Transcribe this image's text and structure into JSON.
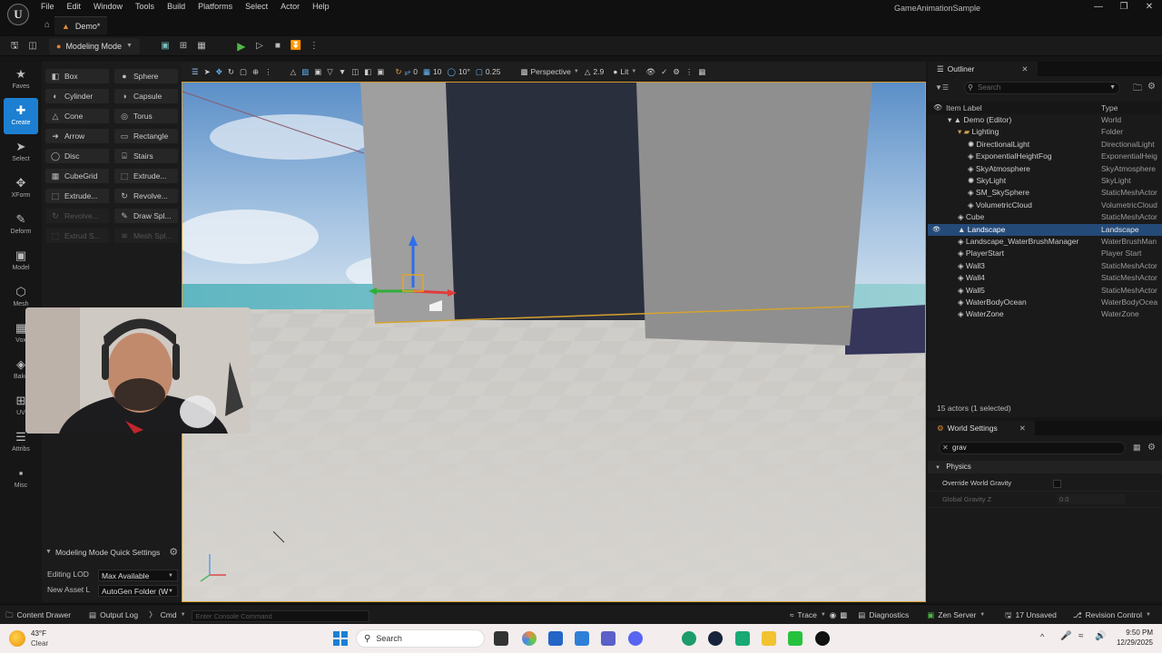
{
  "app": {
    "title": "GameAnimationSample",
    "level_tab": "Demo*",
    "menus": [
      "File",
      "Edit",
      "Window",
      "Tools",
      "Build",
      "Platforms",
      "Select",
      "Actor",
      "Help"
    ]
  },
  "toolbar": {
    "mode_label": "Modeling Mode"
  },
  "modebar": {
    "items": [
      {
        "label": "Faves",
        "icon": "star-icon"
      },
      {
        "label": "Create",
        "icon": "create-icon"
      },
      {
        "label": "Select",
        "icon": "select-icon"
      },
      {
        "label": "XForm",
        "icon": "xform-icon"
      },
      {
        "label": "Deform",
        "icon": "deform-icon"
      },
      {
        "label": "Model",
        "icon": "model-icon"
      },
      {
        "label": "Mesh",
        "icon": "mesh-icon"
      },
      {
        "label": "Vox",
        "icon": "vox-icon"
      },
      {
        "label": "Bake",
        "icon": "bake-icon"
      },
      {
        "label": "UV",
        "icon": "uv-icon"
      },
      {
        "label": "Attribs",
        "icon": "attribs-icon"
      },
      {
        "label": "Misc",
        "icon": "misc-icon"
      }
    ],
    "active": "Create"
  },
  "palette": {
    "tools": [
      {
        "label": "Box",
        "icon": "box-icon",
        "enabled": true
      },
      {
        "label": "Sphere",
        "icon": "sphere-icon",
        "enabled": true
      },
      {
        "label": "Cylinder",
        "icon": "cylinder-icon",
        "enabled": true
      },
      {
        "label": "Capsule",
        "icon": "capsule-icon",
        "enabled": true
      },
      {
        "label": "Cone",
        "icon": "cone-icon",
        "enabled": true
      },
      {
        "label": "Torus",
        "icon": "torus-icon",
        "enabled": true
      },
      {
        "label": "Arrow",
        "icon": "arrow-icon",
        "enabled": true
      },
      {
        "label": "Rectangle",
        "icon": "rectangle-icon",
        "enabled": true
      },
      {
        "label": "Disc",
        "icon": "disc-icon",
        "enabled": true
      },
      {
        "label": "Stairs",
        "icon": "stairs-icon",
        "enabled": true
      },
      {
        "label": "CubeGrid",
        "icon": "cubegrid-icon",
        "enabled": true
      },
      {
        "label": "Extrude...",
        "icon": "extrude-icon",
        "enabled": true
      },
      {
        "label": "Extrude...",
        "icon": "extrude-path-icon",
        "enabled": true
      },
      {
        "label": "Revolve...",
        "icon": "revolve-icon",
        "enabled": true
      },
      {
        "label": "Revolve...",
        "icon": "revolve-path-icon",
        "enabled": false
      },
      {
        "label": "Draw Spl...",
        "icon": "draw-spline-icon",
        "enabled": true
      },
      {
        "label": "Extrud S...",
        "icon": "extrude-spline-icon",
        "enabled": false
      },
      {
        "label": "Mesh Spl...",
        "icon": "mesh-spline-icon",
        "enabled": false
      }
    ]
  },
  "quick_settings": {
    "title": "Modeling Mode Quick Settings",
    "editing_lod_label": "Editing LOD",
    "editing_lod_value": "Max Available",
    "new_asset_label": "New Asset L",
    "new_asset_value": "AutoGen Folder (W"
  },
  "viewport_toolbar": {
    "grid_rot": "0",
    "snap_move": "10",
    "snap_rot": "10°",
    "snap_scale": "0.25",
    "view_mode": "Perspective",
    "camera_speed": "2.9",
    "lighting": "Lit"
  },
  "outliner": {
    "tab": "Outliner",
    "search_placeholder": "Search",
    "col_label": "Item Label",
    "col_type": "Type",
    "rows": [
      {
        "name": "Demo (Editor)",
        "type": "World",
        "depth": 0,
        "kind": "world"
      },
      {
        "name": "Lighting",
        "type": "Folder",
        "depth": 1,
        "kind": "folder"
      },
      {
        "name": "DirectionalLight",
        "type": "DirectionalLight",
        "depth": 2,
        "kind": "light"
      },
      {
        "name": "ExponentialHeightFog",
        "type": "ExponentialHeig",
        "depth": 2,
        "kind": "actor"
      },
      {
        "name": "SkyAtmosphere",
        "type": "SkyAtmosphere",
        "depth": 2,
        "kind": "actor"
      },
      {
        "name": "SkyLight",
        "type": "SkyLight",
        "depth": 2,
        "kind": "light"
      },
      {
        "name": "SM_SkySphere",
        "type": "StaticMeshActor",
        "depth": 2,
        "kind": "actor"
      },
      {
        "name": "VolumetricCloud",
        "type": "VolumetricCloud",
        "depth": 2,
        "kind": "actor"
      },
      {
        "name": "Cube",
        "type": "StaticMeshActor",
        "depth": 1,
        "kind": "actor"
      },
      {
        "name": "Landscape",
        "type": "Landscape",
        "depth": 1,
        "kind": "landscape",
        "selected": true
      },
      {
        "name": "Landscape_WaterBrushManager",
        "type": "WaterBrushMan",
        "depth": 1,
        "kind": "actor"
      },
      {
        "name": "PlayerStart",
        "type": "Player Start",
        "depth": 1,
        "kind": "actor"
      },
      {
        "name": "Wall3",
        "type": "StaticMeshActor",
        "depth": 1,
        "kind": "actor"
      },
      {
        "name": "Wall4",
        "type": "StaticMeshActor",
        "depth": 1,
        "kind": "actor"
      },
      {
        "name": "Wall5",
        "type": "StaticMeshActor",
        "depth": 1,
        "kind": "actor"
      },
      {
        "name": "WaterBodyOcean",
        "type": "WaterBodyOcea",
        "depth": 1,
        "kind": "actor"
      },
      {
        "name": "WaterZone",
        "type": "WaterZone",
        "depth": 1,
        "kind": "actor"
      }
    ],
    "status": "15 actors (1 selected)"
  },
  "world_settings": {
    "tab": "World Settings",
    "search_value": "grav",
    "section": "Physics",
    "override_label": "Override World Gravity",
    "override_checked": false,
    "gravity_label": "Global Gravity Z",
    "gravity_value": "0.0"
  },
  "statusbar": {
    "content_drawer": "Content Drawer",
    "output_log": "Output Log",
    "cmd": "Cmd",
    "console_placeholder": "Enter Console Command",
    "trace": "Trace",
    "diagnostics": "Diagnostics",
    "zen_server": "Zen Server",
    "unsaved": "17 Unsaved",
    "revision_control": "Revision Control"
  },
  "taskbar": {
    "weather_temp": "43°F",
    "weather_desc": "Clear",
    "search_label": "Search",
    "time": "9:50 PM",
    "date": "12/29/2025"
  },
  "colors": {
    "accent": "#1d7fd1",
    "selection": "#244a78",
    "play": "#4fb846",
    "viewport_border": "#d59a2a"
  }
}
